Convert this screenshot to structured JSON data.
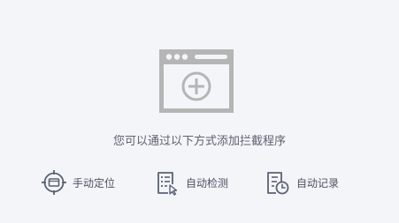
{
  "empty_state": {
    "icon": "browser-window-add-icon",
    "hint": "您可以通过以下方式添加拦截程序"
  },
  "actions": [
    {
      "id": "manual",
      "icon": "crosshair-target-icon",
      "label": "手动定位"
    },
    {
      "id": "detect",
      "icon": "list-cursor-icon",
      "label": "自动检测"
    },
    {
      "id": "record",
      "icon": "document-clock-icon",
      "label": "自动记录"
    }
  ],
  "colors": {
    "background": "#f3f5f9",
    "illustration": "#b9b9b9",
    "icon": "#5b6175",
    "text": "#5e6270"
  }
}
